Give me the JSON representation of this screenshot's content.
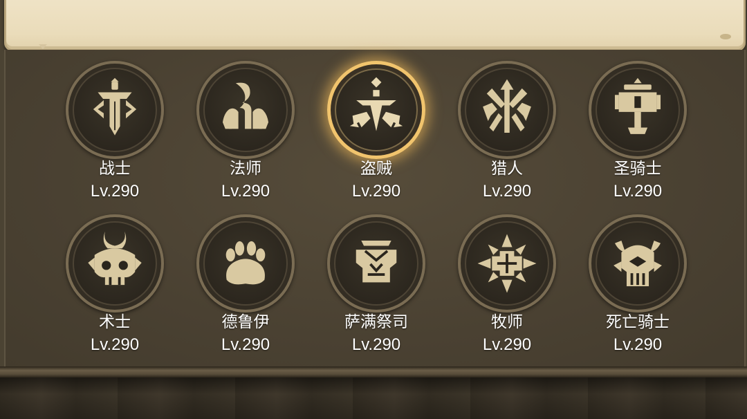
{
  "theme": {
    "accent": "#f1c46d",
    "icon_color": "#d9c9a1",
    "text": "#ffffff"
  },
  "classes": [
    {
      "name": "战士",
      "level": "Lv.290",
      "icon": "sword-shield-icon",
      "selected": false
    },
    {
      "name": "法师",
      "level": "Lv.290",
      "icon": "arcane-flame-icon",
      "selected": false
    },
    {
      "name": "盗贼",
      "level": "Lv.290",
      "icon": "crossed-daggers-icon",
      "selected": true
    },
    {
      "name": "猎人",
      "level": "Lv.290",
      "icon": "arrow-axes-icon",
      "selected": false
    },
    {
      "name": "圣骑士",
      "level": "Lv.290",
      "icon": "holy-hammer-icon",
      "selected": false
    },
    {
      "name": "术士",
      "level": "Lv.290",
      "icon": "demon-skull-icon",
      "selected": false
    },
    {
      "name": "德鲁伊",
      "level": "Lv.290",
      "icon": "bear-paw-icon",
      "selected": false
    },
    {
      "name": "萨满祭司",
      "level": "Lv.290",
      "icon": "totem-icon",
      "selected": false
    },
    {
      "name": "牧师",
      "level": "Lv.290",
      "icon": "holy-star-icon",
      "selected": false
    },
    {
      "name": "死亡骑士",
      "level": "Lv.290",
      "icon": "rune-helm-icon",
      "selected": false
    }
  ]
}
